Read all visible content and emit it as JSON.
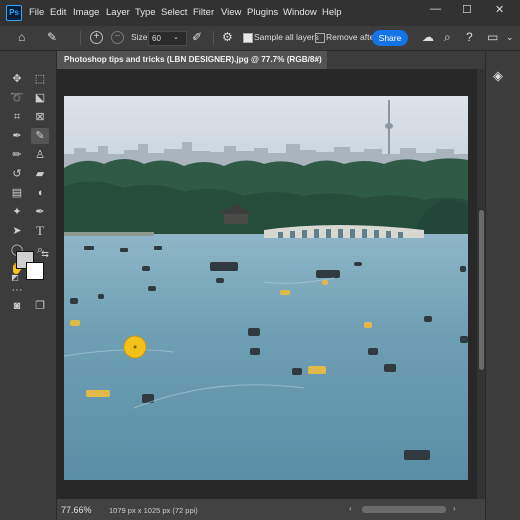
{
  "app": {
    "logo_text": "Ps"
  },
  "menu": [
    "File",
    "Edit",
    "Image",
    "Layer",
    "Type",
    "Select",
    "Filter",
    "View",
    "Plugins",
    "Window",
    "Help"
  ],
  "window_controls": {
    "minimize": "—",
    "maximize": "☐",
    "close": "✕"
  },
  "options_bar": {
    "size_label": "Size",
    "size_value": "60",
    "sample_all_layers_label": "Sample all layers",
    "sample_all_layers_checked": true,
    "remove_after_label": "Remove after",
    "remove_after_checked": false,
    "share_label": "Share"
  },
  "document": {
    "tab_title": "Photoshop tips and tricks (LBN DESIGNER).jpg @ 77.7% (RGB/8#)",
    "close_glyph": "×"
  },
  "status": {
    "zoom": "77.66%",
    "doc_info": "1079 px x 1025 px (72 ppi)"
  },
  "colors": {
    "foreground": "#d0d0d0",
    "background": "#ffffff",
    "accent": "#1473e6",
    "brush_cursor": "#f2c21b"
  },
  "tools": [
    "move-icon",
    "marquee-icon",
    "lasso-icon",
    "object-select-icon",
    "crop-icon",
    "frame-icon",
    "eyedropper-icon",
    "remove-tool-icon",
    "brush-icon",
    "stamp-icon",
    "history-brush-icon",
    "eraser-icon",
    "gradient-icon",
    "blur-icon",
    "dodge-icon",
    "pen-icon",
    "type-icon",
    "path-select-icon",
    "shape-icon",
    "hand-icon",
    "zoom-icon",
    "more-tools-icon",
    "quick-mask-icon",
    "screen-mode-icon"
  ]
}
